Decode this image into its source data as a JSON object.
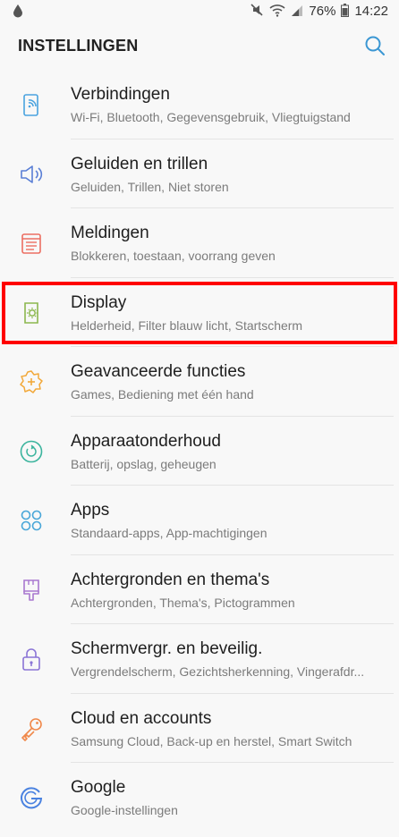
{
  "status_bar": {
    "battery_percent": "76%",
    "time": "14:22",
    "icons": [
      "drop-icon",
      "mute-icon",
      "wifi-icon",
      "signal-icon",
      "battery-icon"
    ]
  },
  "header": {
    "title": "INSTELLINGEN",
    "search_icon": "search-icon"
  },
  "colors": {
    "highlight_border": "#ff0000",
    "search_icon": "#3b97d3"
  },
  "items": [
    {
      "label": "Verbindingen",
      "sub": "Wi-Fi, Bluetooth, Gegevensgebruik, Vliegtuigstand",
      "icon": "connections-icon",
      "color": "#4aa3df"
    },
    {
      "label": "Geluiden en trillen",
      "sub": "Geluiden, Trillen, Niet storen",
      "icon": "sound-icon",
      "color": "#5a7fd6"
    },
    {
      "label": "Meldingen",
      "sub": "Blokkeren, toestaan, voorrang geven",
      "icon": "notifications-icon",
      "color": "#ec6f62"
    },
    {
      "label": "Display",
      "sub": "Helderheid, Filter blauw licht, Startscherm",
      "icon": "display-icon",
      "color": "#8cb84f"
    },
    {
      "label": "Geavanceerde functies",
      "sub": "Games, Bediening met één hand",
      "icon": "advanced-features-icon",
      "color": "#f2a93b"
    },
    {
      "label": "Apparaatonderhoud",
      "sub": "Batterij, opslag, geheugen",
      "icon": "device-maintenance-icon",
      "color": "#3bb49d"
    },
    {
      "label": "Apps",
      "sub": "Standaard-apps, App-machtigingen",
      "icon": "apps-icon",
      "color": "#48a6d8"
    },
    {
      "label": "Achtergronden en thema's",
      "sub": "Achtergronden, Thema's, Pictogrammen",
      "icon": "themes-icon",
      "color": "#a978cf"
    },
    {
      "label": "Schermvergr. en beveilig.",
      "sub": "Vergrendelscherm, Gezichtsherkenning, Vingerafdr...",
      "icon": "lock-icon",
      "color": "#8a74d6"
    },
    {
      "label": "Cloud en accounts",
      "sub": "Samsung Cloud, Back-up en herstel, Smart Switch",
      "icon": "key-icon",
      "color": "#f0884a"
    },
    {
      "label": "Google",
      "sub": "Google-instellingen",
      "icon": "google-icon",
      "color": "#4a82e0"
    }
  ],
  "highlighted_item": "Display"
}
